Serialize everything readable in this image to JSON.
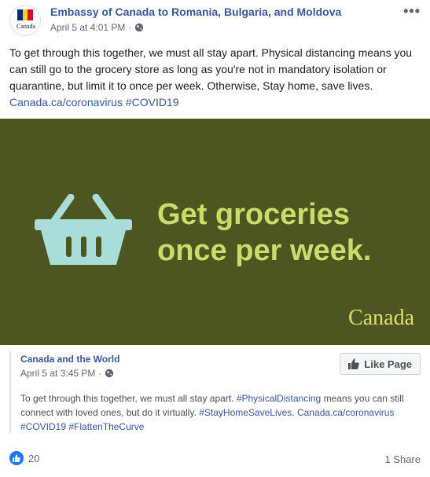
{
  "post": {
    "page_name": "Embassy of Canada to Romania, Bulgaria, and Moldova",
    "avatar_label": "Canada",
    "timestamp": "April 5 at 4:01 PM",
    "privacy_icon": "globe-icon",
    "more_icon": "more-options-icon",
    "text": "To get through this together, we must all stay apart. Physical distancing means you can still go to the grocery store as long as you're not in mandatory isolation or quarantine, but limit it to once per week. Otherwise, Stay home, save lives.",
    "link": "Canada.ca/coronavirus",
    "hashtag": "#COVID19"
  },
  "banner": {
    "line1": "Get groceries",
    "line2": "once per week.",
    "wordmark": "Canada",
    "background_color": "#4d5620",
    "text_color": "#c8dd6a",
    "basket_color": "#a8ddd9"
  },
  "shared": {
    "page_name": "Canada and the World",
    "timestamp": "April 5 at 3:45 PM",
    "like_page_label": "Like Page",
    "text_part1": "To get through this together, we must all stay apart.",
    "hashtag1": "#PhysicalDistancing",
    "text_part2": "means you can still connect with loved ones, but do it virtually.",
    "hashtag2": "#StayHomeSaveLives.",
    "link": "Canada.ca/coronavirus",
    "hashtag3": "#COVID19",
    "hashtag4": "#FlattenTheCurve"
  },
  "footer": {
    "reaction_count": "20",
    "shares": "1 Share"
  },
  "colors": {
    "link": "#385898",
    "like_blue": "#1877f2"
  }
}
